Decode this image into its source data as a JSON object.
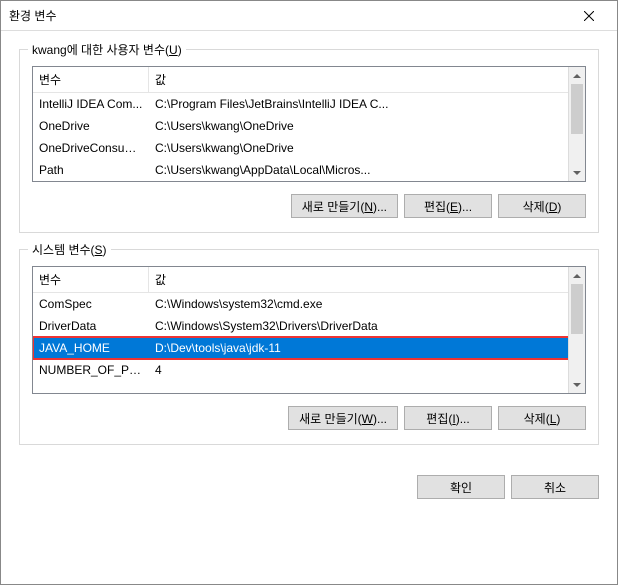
{
  "title": "환경 변수",
  "userSection": {
    "label_prefix": "kwang에 대한 사용자 변수(",
    "label_key": "U",
    "label_suffix": ")",
    "headers": {
      "name": "변수",
      "value": "값"
    },
    "rows": [
      {
        "name": "IntelliJ IDEA Com...",
        "value": "C:\\Program Files\\JetBrains\\IntelliJ IDEA C..."
      },
      {
        "name": "OneDrive",
        "value": "C:\\Users\\kwang\\OneDrive"
      },
      {
        "name": "OneDriveConsumer",
        "value": "C:\\Users\\kwang\\OneDrive"
      },
      {
        "name": "Path",
        "value": "C:\\Users\\kwang\\AppData\\Local\\Micros..."
      }
    ],
    "buttons": {
      "new_prefix": "새로 만들기(",
      "new_key": "N",
      "new_suffix": ")...",
      "edit_prefix": "편집(",
      "edit_key": "E",
      "edit_suffix": ")...",
      "delete_prefix": "삭제(",
      "delete_key": "D",
      "delete_suffix": ")"
    }
  },
  "systemSection": {
    "label_prefix": "시스템 변수(",
    "label_key": "S",
    "label_suffix": ")",
    "headers": {
      "name": "변수",
      "value": "값"
    },
    "rows": [
      {
        "name": "ComSpec",
        "value": "C:\\Windows\\system32\\cmd.exe"
      },
      {
        "name": "DriverData",
        "value": "C:\\Windows\\System32\\Drivers\\DriverData"
      },
      {
        "name": "JAVA_HOME",
        "value": "D:\\Dev\\tools\\java\\jdk-11"
      },
      {
        "name": "NUMBER_OF_PRO...",
        "value": "4"
      }
    ],
    "selectedIndex": 2,
    "buttons": {
      "new_prefix": "새로 만들기(",
      "new_key": "W",
      "new_suffix": ")...",
      "edit_prefix": "편집(",
      "edit_key": "I",
      "edit_suffix": ")...",
      "delete_prefix": "삭제(",
      "delete_key": "L",
      "delete_suffix": ")"
    }
  },
  "footer": {
    "ok": "확인",
    "cancel": "취소"
  }
}
